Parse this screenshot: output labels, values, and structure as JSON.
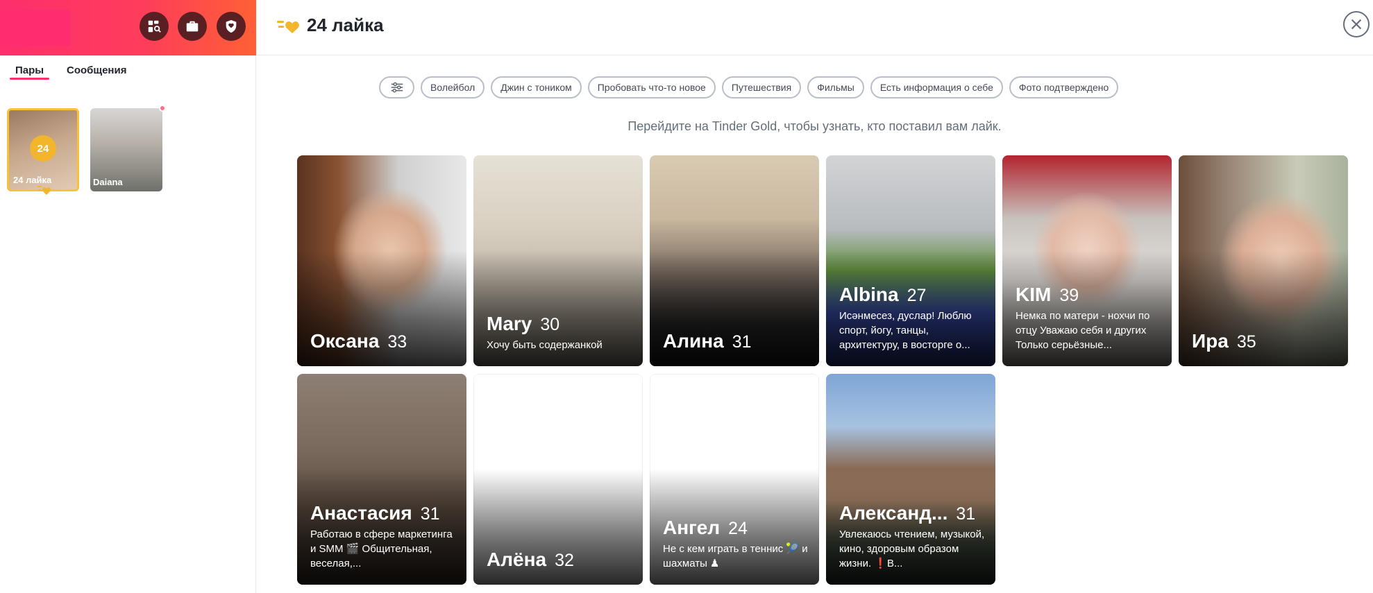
{
  "sidebar": {
    "tabs": [
      {
        "label": "Пары"
      },
      {
        "label": "Сообщения"
      }
    ],
    "likes_card": {
      "count": "24",
      "label": "24 лайка"
    },
    "matches": [
      {
        "name": "Daiana",
        "new": true
      }
    ],
    "header_icons": [
      "explore-icon",
      "briefcase-icon",
      "shield-icon"
    ]
  },
  "main": {
    "title": "24 лайка",
    "close_icon": "close-icon",
    "filters": [
      "Волейбол",
      "Джин с тоником",
      "Пробовать что-то новое",
      "Путешествия",
      "Фильмы",
      "Есть информация о себе",
      "Фото подтверждено"
    ],
    "gold_note": "Перейдите на Tinder Gold, чтобы узнать, кто поставил вам лайк.",
    "cards": [
      {
        "name": "Оксана",
        "age": "33",
        "bio": ""
      },
      {
        "name": "Mary",
        "age": "30",
        "bio": "Хочу быть содержанкой"
      },
      {
        "name": "Алина",
        "age": "31",
        "bio": ""
      },
      {
        "name": "Albina",
        "age": "27",
        "bio": "Исәнмесез, дуслар! Люблю спорт, йогу, танцы, архитектуру, в восторге о..."
      },
      {
        "name": "KIM",
        "age": "39",
        "bio": "Немка по матери - нохчи по отцу Уважаю себя и других Только серьёзные..."
      },
      {
        "name": "Ира",
        "age": "35",
        "bio": ""
      },
      {
        "name": "Анастасия",
        "age": "31",
        "bio": "Работаю в сфере маркетинга и SMM 🎬 Общительная, веселая,..."
      },
      {
        "name": "Алёна",
        "age": "32",
        "bio": ""
      },
      {
        "name": "Ангел",
        "age": "24",
        "bio": "Не с кем играть в теннис 🎾 и шахматы ♟"
      },
      {
        "name": "Александ...",
        "age": "31",
        "bio": "Увлекаюсь чтением, музыкой, кино, здоровым образом жизни. ❗В..."
      }
    ]
  },
  "colors": {
    "brand_gradient_start": "#fd2f6c",
    "brand_gradient_end": "#ff6036",
    "gold": "#f2b52b",
    "text_primary": "#21262e",
    "text_secondary": "#656e7b"
  }
}
